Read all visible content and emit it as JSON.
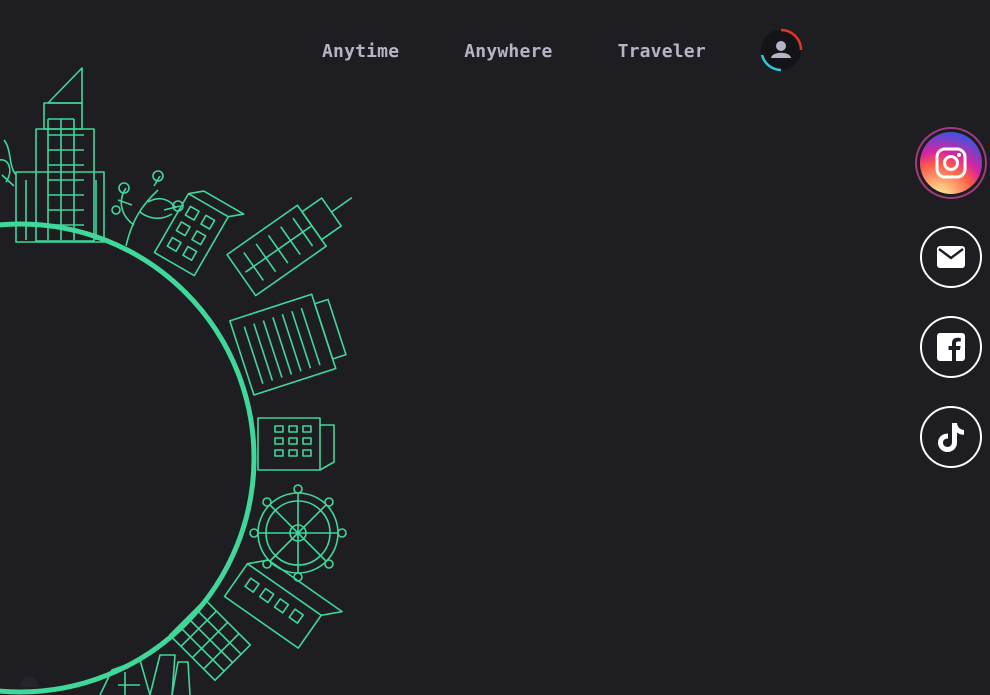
{
  "nav": {
    "items": [
      {
        "label": "Anytime"
      },
      {
        "label": "Anywhere"
      },
      {
        "label": "Traveler"
      }
    ]
  },
  "colors": {
    "background": "#1e1d22",
    "accent": "#3fd89a",
    "nav_text": "#b5b5c5",
    "avatar_ring_top": "#e0352b",
    "avatar_ring_bottom": "#2ec7e0"
  },
  "profile": {
    "icon": "user-avatar-icon"
  },
  "social": [
    {
      "name": "instagram",
      "icon": "instagram-icon"
    },
    {
      "name": "email",
      "icon": "mail-icon"
    },
    {
      "name": "facebook",
      "icon": "facebook-icon"
    },
    {
      "name": "tiktok",
      "icon": "tiktok-icon"
    }
  ]
}
